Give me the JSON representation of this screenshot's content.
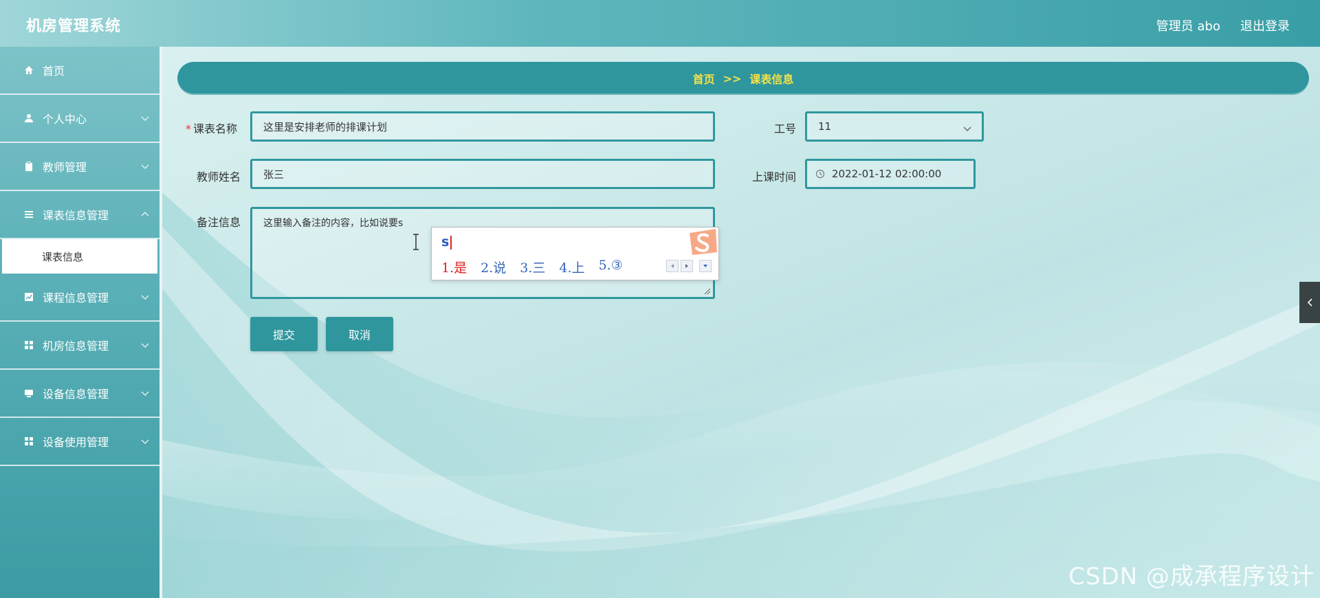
{
  "header": {
    "app_title": "机房管理系统",
    "user_info": "管理员 abo",
    "logout_label": "退出登录"
  },
  "sidebar": {
    "items": [
      {
        "label": "首页",
        "icon": "home-icon"
      },
      {
        "label": "个人中心",
        "icon": "user-icon"
      },
      {
        "label": "教师管理",
        "icon": "clipboard-icon"
      },
      {
        "label": "课表信息管理",
        "icon": "list-icon"
      },
      {
        "label": "课表信息",
        "icon": ""
      },
      {
        "label": "课程信息管理",
        "icon": "chart-icon"
      },
      {
        "label": "机房信息管理",
        "icon": "grid-icon"
      },
      {
        "label": "设备信息管理",
        "icon": "monitor-icon"
      },
      {
        "label": "设备使用管理",
        "icon": "grid-icon"
      }
    ]
  },
  "breadcrumb": {
    "home": "首页",
    "separator": ">>",
    "current": "课表信息"
  },
  "form": {
    "schedule_name": {
      "label": "课表名称",
      "required_mark": "*",
      "value": "这里是安排老师的排课计划"
    },
    "teacher_name": {
      "label": "教师姓名",
      "value": "张三"
    },
    "remarks": {
      "label": "备注信息",
      "value": "这里输入备注的内容，比如说要s"
    },
    "work_id": {
      "label": "工号",
      "value": "11"
    },
    "class_time": {
      "label": "上课时间",
      "value": "2022-01-12 02:00:00"
    },
    "submit_label": "提交",
    "cancel_label": "取消"
  },
  "ime": {
    "input": "s",
    "candidates": [
      "1.是",
      "2.说",
      "3.三",
      "4.上",
      "5.③"
    ]
  },
  "watermark": "CSDN @成承程序设计",
  "colors": {
    "accent": "#2f969d",
    "breadcrumb_text": "#f4e24a",
    "header": "#5fb7bd"
  }
}
